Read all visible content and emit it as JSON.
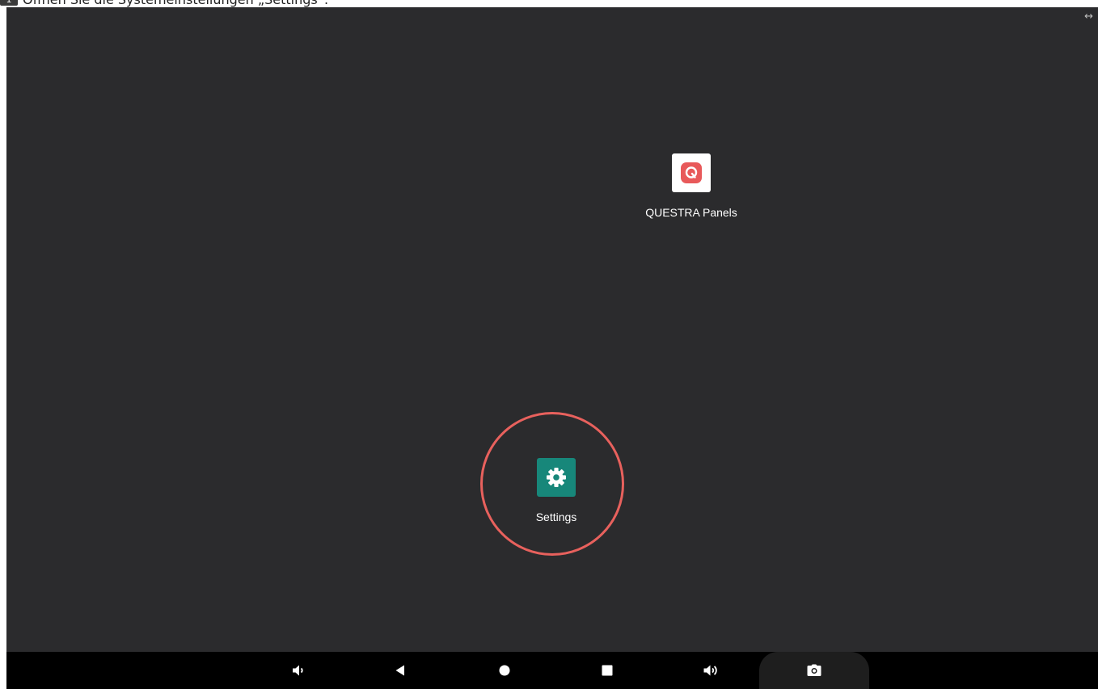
{
  "caption": {
    "step_number": "1",
    "text": "Öffnen Sie die Systemeinstellungen „Settings“."
  },
  "screen": {
    "resize_icon": "resize-horizontal-icon",
    "apps": [
      {
        "label": "QUESTRA Panels",
        "icon": "questra-panels-icon",
        "icon_color": "#e8595a"
      },
      {
        "label": "Settings",
        "icon": "settings-gear-icon",
        "icon_color": "#17877a"
      }
    ],
    "highlight_color": "#e8615d"
  },
  "navbar": {
    "buttons": [
      {
        "name": "volume-down-icon"
      },
      {
        "name": "back-icon"
      },
      {
        "name": "home-icon"
      },
      {
        "name": "recents-icon"
      },
      {
        "name": "volume-up-icon"
      },
      {
        "name": "camera-icon"
      }
    ]
  }
}
